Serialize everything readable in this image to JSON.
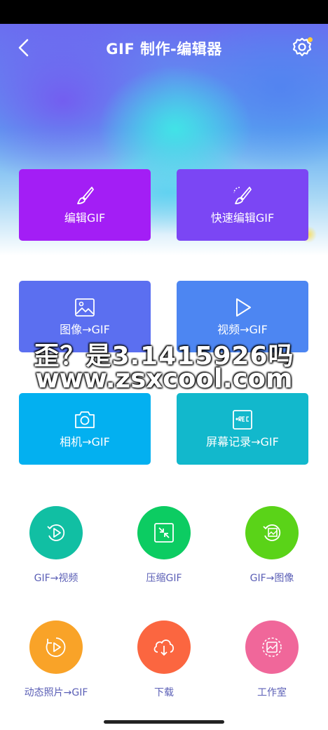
{
  "app_bar": {
    "title": "GIF 制作-编辑器",
    "back_icon": "chevron-left-icon",
    "settings_icon": "gear-icon",
    "settings_dot_color": "#ffc83a"
  },
  "tiles": [
    {
      "label": "编辑GIF",
      "icon": "brush-icon",
      "color": "#a31ef5"
    },
    {
      "label": "快速编辑GIF",
      "icon": "quick-brush-icon",
      "color": "#7b46f4"
    },
    {
      "label": "图像→GIF",
      "icon": "image-icon",
      "color": "#5b6ff0"
    },
    {
      "label": "视频→GIF",
      "icon": "play-icon",
      "color": "#4d86f2"
    },
    {
      "label": "相机→GIF",
      "icon": "camera-icon",
      "color": "#03b0f0"
    },
    {
      "label": "屏幕记录→GIF",
      "icon": "rec-icon",
      "color": "#12b8cc"
    }
  ],
  "tools": [
    {
      "label": "GIF→视频",
      "icon": "gif-to-video-icon",
      "color": "#11bfa3"
    },
    {
      "label": "压缩GIF",
      "icon": "compress-icon",
      "color": "#0ccc62"
    },
    {
      "label": "GIF→图像",
      "icon": "gif-to-image-icon",
      "color": "#5ad318"
    },
    {
      "label": "动态照片→GIF",
      "icon": "live-photo-icon",
      "color": "#f9a328"
    },
    {
      "label": "下载",
      "icon": "cloud-download-icon",
      "color": "#fb6640"
    },
    {
      "label": "工作室",
      "icon": "studio-icon",
      "color": "#f0679a"
    }
  ],
  "watermark": {
    "line1": "歪？是3.1415926吗",
    "line2": "www.zsxcool.com"
  }
}
